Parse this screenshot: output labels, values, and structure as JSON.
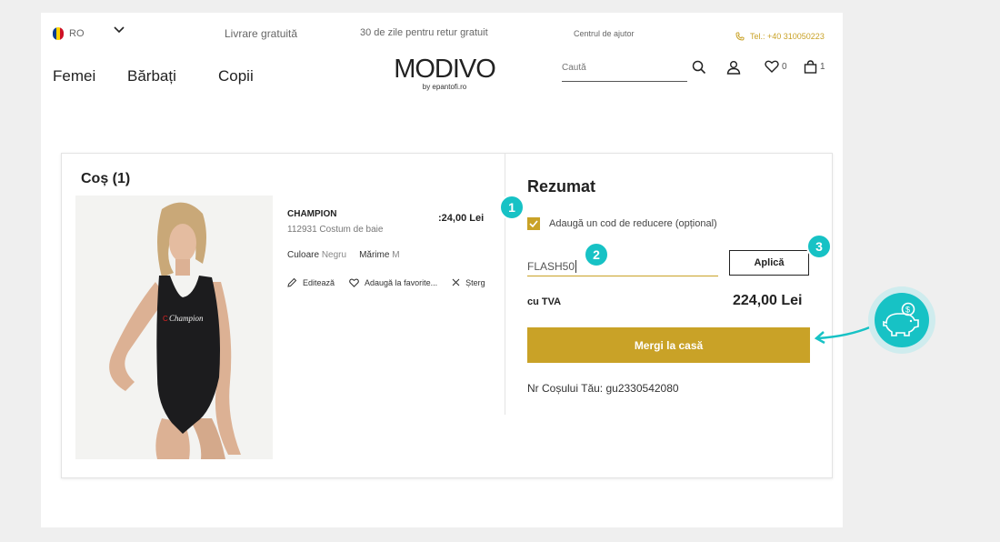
{
  "topbar": {
    "lang": "RO",
    "free_shipping": "Livrare gratuită",
    "returns": "30 de zile pentru retur gratuit",
    "help": "Centrul de ajutor",
    "phone": "Tel.: +40 310050223"
  },
  "header": {
    "nav": [
      "Femei",
      "Bărbați",
      "Copii"
    ],
    "logo": "MODIVO",
    "logo_sub": "by epantofi.ro",
    "search_placeholder": "Caută",
    "wishlist_count": "0",
    "bag_count": "1"
  },
  "cart": {
    "title": "Coș (1)",
    "product": {
      "brand": "CHAMPION",
      "price": ":24,00 Lei",
      "code": "112931 Costum de baie",
      "color_label": "Culoare",
      "color_value": "Negru",
      "size_label": "Mărime",
      "size_value": "M",
      "edit": "Editează",
      "favorite": "Adaugă la favorite...",
      "remove": "Șterg"
    }
  },
  "summary": {
    "title": "Rezumat",
    "discount_label": "Adaugă un cod de reducere (opțional)",
    "discount_checked": true,
    "code_value": "FLASH50",
    "apply": "Aplică",
    "vat_label": "cu TVA",
    "total": "224,00 Lei",
    "checkout": "Mergi la casă",
    "cart_number": "Nr Coșului Tău: gu2330542080"
  },
  "annotations": [
    "1",
    "2",
    "3"
  ],
  "colors": {
    "accent": "#c9a227",
    "badge": "#17c2c5",
    "page_bg": "#efefef"
  }
}
